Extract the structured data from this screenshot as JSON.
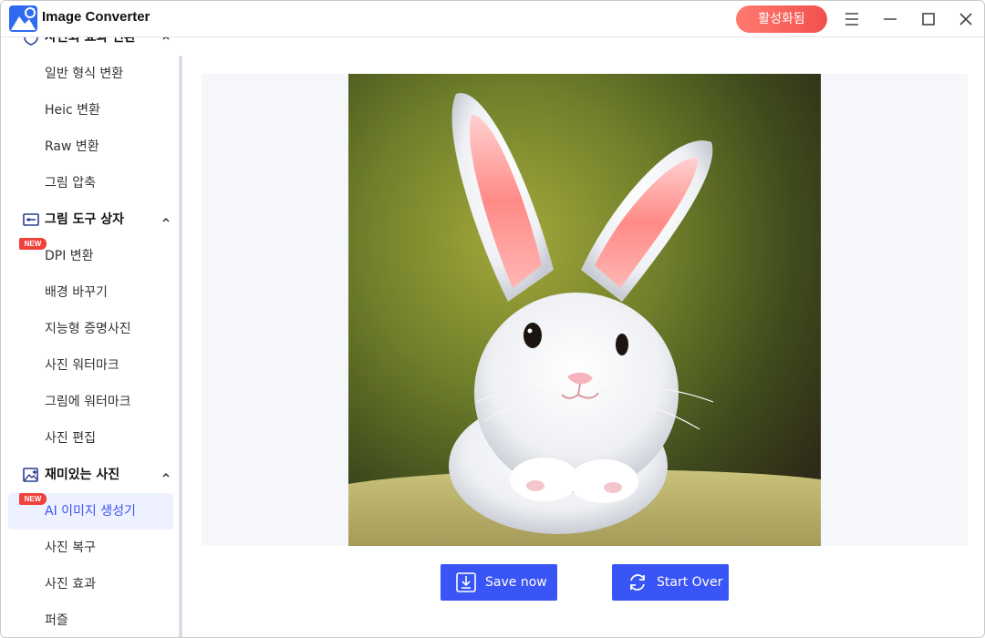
{
  "app": {
    "title": "Image Converter",
    "activate_label": "활성화됨"
  },
  "sidebar": {
    "partial_group_label": "사진회 효과 변환",
    "items_top": [
      {
        "label": "일반 형식 변환"
      },
      {
        "label": "Heic 변환"
      },
      {
        "label": "Raw 변환"
      },
      {
        "label": "그림 압축"
      }
    ],
    "group_tools": {
      "label": "그림 도구 상자"
    },
    "items_tools": [
      {
        "label": "DPI 변환",
        "badge": "NEW"
      },
      {
        "label": "배경 바꾸기"
      },
      {
        "label": "지능형 증명사진"
      },
      {
        "label": "사진 워터마크"
      },
      {
        "label": "그림에 워터마크"
      },
      {
        "label": "사진 편집"
      }
    ],
    "group_fun": {
      "label": "재미있는 사진"
    },
    "items_fun": [
      {
        "label": "AI 이미지 생성기",
        "badge": "NEW",
        "active": true
      },
      {
        "label": "사진 복구"
      },
      {
        "label": "사진 효과"
      },
      {
        "label": "퍼즐"
      }
    ]
  },
  "main": {
    "save_label": "Save now",
    "start_over_label": "Start Over"
  },
  "colors": {
    "accent": "#3a55f5",
    "badge": "#f0423c",
    "activate": "#f2504d"
  }
}
